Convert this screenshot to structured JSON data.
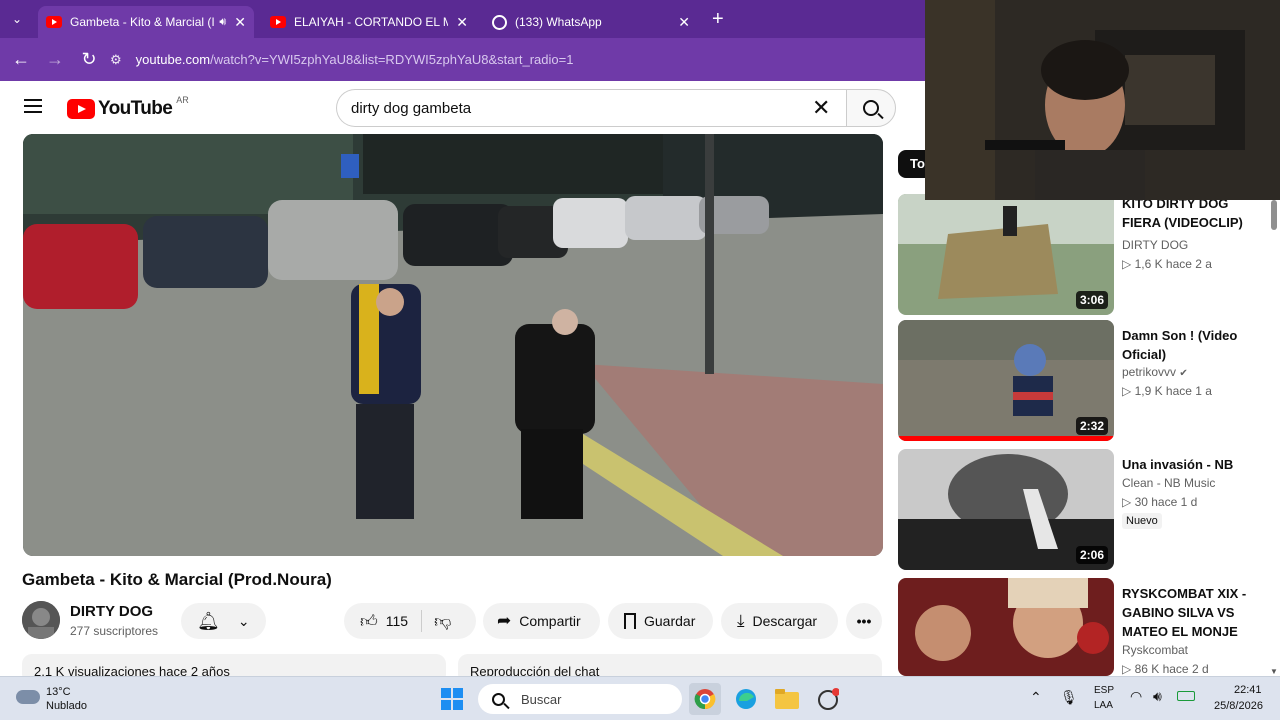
{
  "browser": {
    "tabs": [
      {
        "title": "Gambeta - Kito & Marcial (I",
        "active": true,
        "icon": "youtube-icon"
      },
      {
        "title": "ELAIYAH - CORTANDO EL MAM",
        "active": false,
        "icon": "youtube-icon"
      },
      {
        "title": "(133) WhatsApp",
        "active": false,
        "icon": "whatsapp-icon"
      }
    ],
    "new_tab": "+",
    "url_host": "youtube.com",
    "url_path": "/watch?v=YWI5zphYaU8&list=RDYWI5zphYaU8&start_radio=1"
  },
  "youtube": {
    "logo_text": "YouTube",
    "country_code": "AR",
    "search_value": "dirty dog gambeta",
    "video": {
      "title": "Gambeta - Kito & Marcial (Prod.Noura)",
      "channel": "DIRTY DOG",
      "subscribers": "277 suscriptores",
      "likes": "115",
      "share_label": "Compartir",
      "save_label": "Guardar",
      "download_label": "Descargar",
      "description_preview": "2,1 K visualizaciones  hace 2 años",
      "chat_label": "Reproducción del chat"
    },
    "filter_chip": "To",
    "recommendations": [
      {
        "title": "KITO DIRTY DOG FIERA (VIDEOCLIP)",
        "channel": "DIRTY DOG",
        "meta": "▷ 1,6 K  hace 2 a",
        "duration": "3:06",
        "verified": false,
        "badge": ""
      },
      {
        "title": "Damn Son ! (Video Oficial)",
        "channel": "petrikovvv",
        "meta": "▷ 1,9 K  hace 1 a",
        "duration": "2:32",
        "verified": true,
        "badge": ""
      },
      {
        "title": "Una invasión - NB",
        "channel": "Clean - NB Music",
        "meta": "▷ 30  hace 1 d",
        "duration": "2:06",
        "verified": false,
        "badge": "Nuevo"
      },
      {
        "title": "RYSKCOMBAT XIX - GABINO SILVA VS MATEO EL MONJE",
        "channel": "Ryskcombat",
        "meta": "▷ 86 K  hace 2 d",
        "duration": "",
        "verified": false,
        "badge": ""
      }
    ]
  },
  "taskbar": {
    "weather_temp": "13°C",
    "weather_desc": "Nublado",
    "search_placeholder": "Buscar",
    "lang_top": "ESP",
    "lang_bottom": "LAA",
    "time": "22:41",
    "date": "25/8/2026"
  },
  "colors": {
    "chrome_bar": "#5a2a93",
    "address_bar": "#6f3aa8",
    "yt_red": "#ff0000",
    "taskbar": "#dde3ee"
  }
}
